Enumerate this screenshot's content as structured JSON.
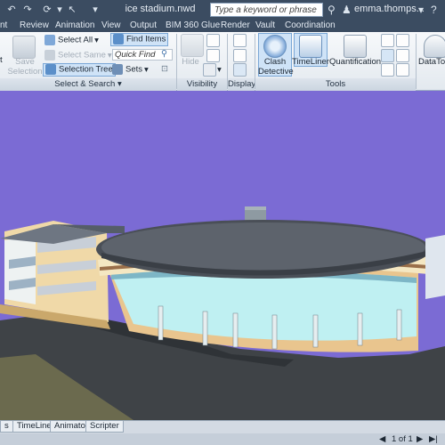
{
  "titlebar": {
    "doc_title": "ice stadium.nwd",
    "search_placeholder": "Type a keyword or phrase",
    "user_name": "emma.thomps...",
    "undo_glyph": "↶",
    "redo_glyph": "↷",
    "refresh_glyph": "⟳",
    "print_glyph": "▾",
    "select_glyph": "↖",
    "more_glyph": "▾",
    "binoculars_glyph": "⚲",
    "user_glyph": "♟",
    "cart_glyph": "▾",
    "help_glyph": "?"
  },
  "tabs": [
    "nt",
    "Review",
    "Animation",
    "View",
    "Output",
    "BIM 360 Glue",
    "Render",
    "Vault",
    "Coordination"
  ],
  "ribbon": {
    "select_all": "Select All",
    "select_same": "Select Same",
    "selection_tree": "Selection Tree",
    "save_selection_1": "Save",
    "save_selection_2": "Selection",
    "find_items": "Find Items",
    "quick_find": "Quick Find",
    "sets": "Sets",
    "hide": "Hide",
    "clash_detective_1": "Clash",
    "clash_detective_2": "Detective",
    "timeliner": "TimeLiner",
    "quantification": "Quantification",
    "datatools": "DataToo",
    "t_left": "t",
    "panel_select_search": "Select & Search",
    "panel_visibility": "Visibility",
    "panel_display": "Display",
    "panel_tools": "Tools",
    "dropdown_glyph": "▾"
  },
  "bottom": {
    "tabs": [
      "s",
      "TimeLiner",
      "Animator",
      "Scripter"
    ],
    "page_text": "1 of 1",
    "nav_first": "◀",
    "nav_next": "▶",
    "nav_last": "▶|"
  },
  "colors": {
    "sky": "#7b6bd4",
    "roof": "#4a4f57",
    "glass": "#bff0f2",
    "ground": "#3f4347",
    "accent": "#cfe3f7"
  }
}
